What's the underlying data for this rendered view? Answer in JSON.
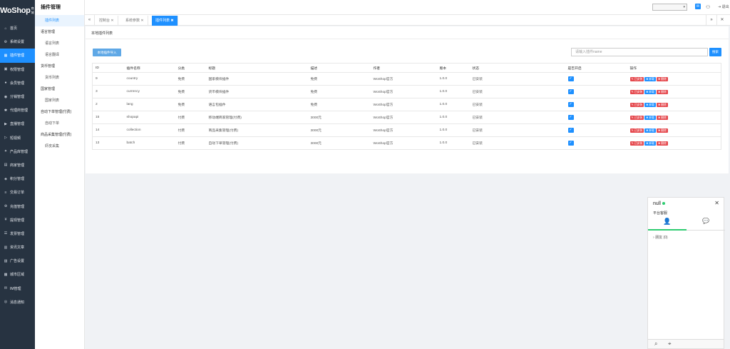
{
  "brand": {
    "logo": "WoShop",
    "logo_sub": "商城"
  },
  "sidebar": {
    "items": [
      {
        "icon": "home-icon",
        "glyph": "⌂",
        "label": "首页"
      },
      {
        "icon": "gear-icon",
        "glyph": "⚙",
        "label": "系统设置"
      },
      {
        "icon": "plug-icon",
        "glyph": "▦",
        "label": "插件管理",
        "active": true
      },
      {
        "icon": "shield-icon",
        "glyph": "▣",
        "label": "权限管理"
      },
      {
        "icon": "user-icon",
        "glyph": "●",
        "label": "会员管理"
      },
      {
        "icon": "share-icon",
        "glyph": "◉",
        "label": "分销管理"
      },
      {
        "icon": "agent-icon",
        "glyph": "✱",
        "label": "代理商管理"
      },
      {
        "icon": "live-icon",
        "glyph": "▶",
        "label": "直播管理"
      },
      {
        "icon": "video-icon",
        "glyph": "▷",
        "label": "短视频"
      },
      {
        "icon": "product-icon",
        "glyph": "✦",
        "label": "产品库管理"
      },
      {
        "icon": "shop-icon",
        "glyph": "▤",
        "label": "商家管理"
      },
      {
        "icon": "points-icon",
        "glyph": "◈",
        "label": "积分管理"
      },
      {
        "icon": "order-icon",
        "glyph": "≡",
        "label": "交易订单"
      },
      {
        "icon": "recharge-icon",
        "glyph": "⊕",
        "label": "充值管理"
      },
      {
        "icon": "withdraw-icon",
        "glyph": "¥",
        "label": "提现管理"
      },
      {
        "icon": "invoice-icon",
        "glyph": "☰",
        "label": "发票管理"
      },
      {
        "icon": "article-icon",
        "glyph": "▥",
        "label": "资讯文章"
      },
      {
        "icon": "ad-icon",
        "glyph": "▨",
        "label": "广告设置"
      },
      {
        "icon": "city-icon",
        "glyph": "▩",
        "label": "城市区域"
      },
      {
        "icon": "im-icon",
        "glyph": "✉",
        "label": "IM管理"
      },
      {
        "icon": "message-icon",
        "glyph": "◎",
        "label": "消息通知"
      }
    ]
  },
  "subnav": {
    "title": "插件管理",
    "entries": [
      {
        "type": "item",
        "label": "插件列表",
        "active": true
      },
      {
        "type": "group",
        "label": "语言管理"
      },
      {
        "type": "item",
        "label": "语言列表"
      },
      {
        "type": "item",
        "label": "语言翻译"
      },
      {
        "type": "group",
        "label": "货币管理"
      },
      {
        "type": "item",
        "label": "货币列表"
      },
      {
        "type": "group",
        "label": "国家管理"
      },
      {
        "type": "item",
        "label": "国家列表"
      },
      {
        "type": "group",
        "label": "自动下单管理(付费)"
      },
      {
        "type": "item",
        "label": "自动下单"
      },
      {
        "type": "group",
        "label": "商品采集管理(付费)"
      },
      {
        "type": "item",
        "label": "虾皮采集"
      }
    ]
  },
  "topbar": {
    "logout": "退出"
  },
  "tabs": [
    {
      "label": "控制台",
      "close": "✕",
      "active": false
    },
    {
      "label": "系统参数",
      "close": "✕",
      "active": false
    },
    {
      "label": "插件列表",
      "close": "✖",
      "active": true
    }
  ],
  "main": {
    "panel_title": "本地插件列表",
    "import_button": "本地插件导入",
    "search_placeholder": "请输入插件name",
    "search_button": "搜索",
    "columns": [
      "ID",
      "插件名称",
      "分类",
      "标题",
      "描述",
      "作者",
      "版本",
      "状态",
      "是否开启",
      "操作"
    ],
    "rows": [
      [
        "9",
        "country",
        "免费",
        "国家模块插件",
        "免费",
        "WoShop官方",
        "1.0.0",
        "已安装"
      ],
      [
        "3",
        "currency",
        "免费",
        "货币模块插件",
        "免费",
        "WoShop官方",
        "1.0.0",
        "已安装"
      ],
      [
        "2",
        "lang",
        "免费",
        "语言包插件",
        "免费",
        "WoShop官方",
        "1.0.0",
        "已安装"
      ],
      [
        "15",
        "shopapi",
        "付费",
        "移动端商家管理(付费)",
        "3000元",
        "WoShop官方",
        "1.0.0",
        "已安装"
      ],
      [
        "14",
        "collection",
        "付费",
        "商品采集管理(付费)",
        "3000元",
        "WoShop官方",
        "1.0.0",
        "已安装"
      ],
      [
        "13",
        "batch",
        "付费",
        "自动下单管理(付费)",
        "3000元",
        "WoShop官方",
        "1.0.0",
        "已安装"
      ]
    ],
    "actions": {
      "install": "已安装",
      "uninstall": "卸载",
      "delete": "删除"
    }
  },
  "chat": {
    "name": "null",
    "subtitle": "平台客服",
    "group": "朋友",
    "group_count": "(0)"
  }
}
